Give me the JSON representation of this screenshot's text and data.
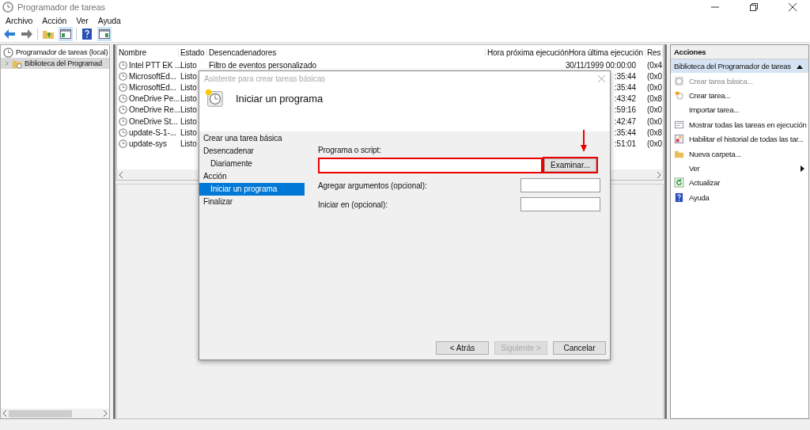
{
  "window": {
    "title": "Programador de tareas"
  },
  "menu": [
    "Archivo",
    "Acción",
    "Ver",
    "Ayuda"
  ],
  "tree": [
    {
      "label": "Programador de tareas (local)",
      "selected": false,
      "children": [
        {
          "label": "Biblioteca del Programad",
          "selected": true
        }
      ]
    }
  ],
  "task_list": {
    "columns": [
      "Nombre",
      "Estado",
      "Desencadenadores",
      "Hora próxima ejecución",
      "Hora última ejecución",
      "Res"
    ],
    "rows": [
      {
        "name": "Intel PTT EK ...",
        "status": "Listo",
        "trigger": "Filtro de eventos personalizado",
        "last_run": "30/11/1999 00:00:00",
        "result": "(0x4"
      },
      {
        "name": "MicrosoftEd...",
        "status": "Listo",
        "last_run": ":35:44",
        "result": "(0x0"
      },
      {
        "name": "MicrosoftEd...",
        "status": "Listo",
        "last_run": ":35:44",
        "result": "(0x0"
      },
      {
        "name": "OneDrive Pe...",
        "status": "Listo",
        "last_run": ":43:42",
        "result": "(0x8"
      },
      {
        "name": "OneDrive Re...",
        "status": "Listo",
        "last_run": ":59:16",
        "result": "(0x0"
      },
      {
        "name": "OneDrive St...",
        "status": "Listo",
        "last_run": ":42:47",
        "result": "(0x0"
      },
      {
        "name": "update-S-1-...",
        "status": "Listo",
        "last_run": ":35:44",
        "result": "(0x8"
      },
      {
        "name": "update-sys",
        "status": "Listo",
        "last_run": ":51:01",
        "result": "(0x0"
      }
    ]
  },
  "dialog": {
    "title": "Asistente para crear tareas básicas",
    "heading": "Iniciar un programa",
    "steps": [
      {
        "label": "Crear una tarea básica",
        "selected": false
      },
      {
        "label": "Desencadenar",
        "selected": false,
        "children": [
          {
            "label": "Diariamente",
            "selected": false
          }
        ]
      },
      {
        "label": "Acción",
        "selected": false,
        "children": [
          {
            "label": "Iniciar un programa",
            "selected": true
          }
        ]
      },
      {
        "label": "Finalizar",
        "selected": false
      }
    ],
    "program_label": "Programa o script:",
    "browse_button": "Examinar...",
    "fields": [
      {
        "label": "Agregar argumentos (opcional):"
      },
      {
        "label": "Iniciar en (opcional):"
      }
    ],
    "buttons": [
      {
        "label": "< Atrás",
        "disabled": false
      },
      {
        "label": "Siguiente >",
        "disabled": true
      },
      {
        "label": "Cancelar",
        "disabled": false
      }
    ]
  },
  "actions": {
    "title": "Acciones",
    "section": "Biblioteca del Programador de tareas",
    "items": [
      {
        "label": "Crear tarea básica...",
        "kind": "wizard",
        "disabled": true,
        "submenu": false
      },
      {
        "label": "Crear tarea...",
        "kind": "task",
        "disabled": false,
        "submenu": false
      },
      {
        "label": "Importar tarea...",
        "kind": "plain",
        "disabled": false,
        "submenu": false
      },
      {
        "label": "Mostrar todas las tareas en ejecución",
        "kind": "list",
        "disabled": false,
        "submenu": false
      },
      {
        "label": "Habilitar el historial de todas las tar...",
        "kind": "history",
        "disabled": false,
        "submenu": false
      },
      {
        "label": "Nueva carpeta...",
        "kind": "folder",
        "disabled": false,
        "submenu": false
      },
      {
        "label": "Ver",
        "kind": "plain",
        "disabled": false,
        "submenu": true
      },
      {
        "label": "Actualizar",
        "kind": "refresh",
        "disabled": false,
        "submenu": false
      },
      {
        "label": "Ayuda",
        "kind": "help",
        "disabled": false,
        "submenu": false
      }
    ]
  }
}
